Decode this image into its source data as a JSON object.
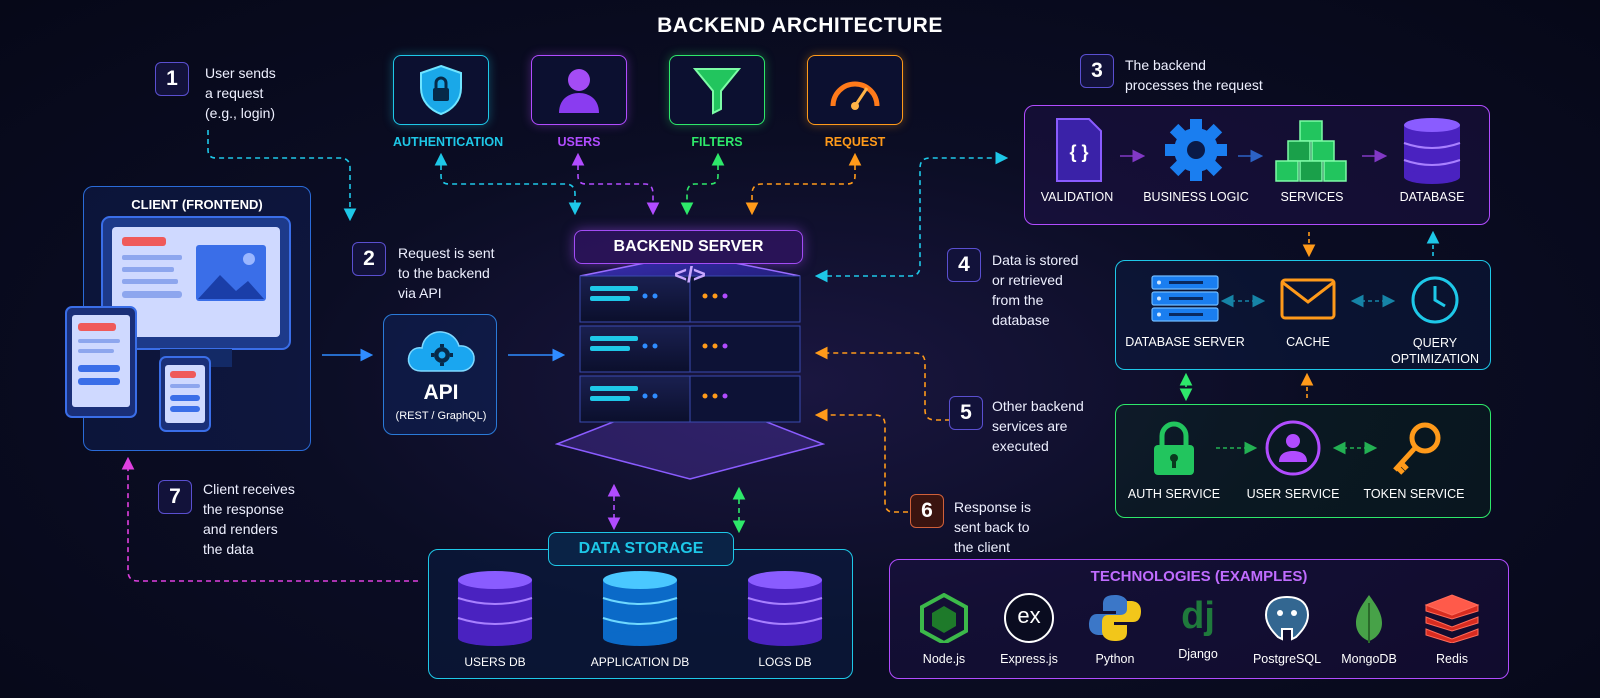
{
  "title": "BACKEND ARCHITECTURE",
  "top_icons": [
    {
      "label": "AUTHENTICATION",
      "icon": "shield-lock-icon",
      "color": "#1ec8e8"
    },
    {
      "label": "USERS",
      "icon": "user-icon",
      "color": "#b14cff"
    },
    {
      "label": "FILTERS",
      "icon": "funnel-icon",
      "color": "#2ee86a"
    },
    {
      "label": "REQUEST",
      "icon": "gauge-icon",
      "color": "#ff9a1a"
    }
  ],
  "steps": {
    "s1": {
      "num": "1",
      "lines": [
        "User sends",
        "a request",
        "(e.g., login)"
      ]
    },
    "s2": {
      "num": "2",
      "lines": [
        "Request is sent",
        "to the backend",
        "via API"
      ]
    },
    "s3": {
      "num": "3",
      "lines": [
        "The backend",
        "processes the request"
      ]
    },
    "s4": {
      "num": "4",
      "lines": [
        "Data is stored",
        "or retrieved",
        "from the",
        "database"
      ]
    },
    "s5": {
      "num": "5",
      "lines": [
        "Other backend",
        "services are",
        "executed"
      ]
    },
    "s6": {
      "num": "6",
      "lines": [
        "Response is",
        "sent back to",
        "the client"
      ]
    },
    "s7": {
      "num": "7",
      "lines": [
        "Client receives",
        "the response",
        "and renders",
        "the data"
      ]
    }
  },
  "client": {
    "label": "CLIENT (FRONTEND)"
  },
  "api": {
    "label": "API",
    "sub": "(REST / GraphQL)"
  },
  "server": {
    "label": "BACKEND SERVER",
    "code": "</>"
  },
  "processing": [
    {
      "label": "VALIDATION",
      "icon": "code-file-icon"
    },
    {
      "label": "BUSINESS LOGIC",
      "icon": "gear-icon"
    },
    {
      "label": "SERVICES",
      "icon": "cubes-icon"
    },
    {
      "label": "DATABASE",
      "icon": "database-icon"
    }
  ],
  "data_layer": {
    "items": [
      {
        "label": "DATABASE SERVER",
        "icon": "server-rack-icon"
      },
      {
        "label": "CACHE",
        "icon": "envelope-icon"
      },
      {
        "label": "QUERY",
        "label2": "OPTIMIZATION",
        "icon": "clock-icon"
      }
    ]
  },
  "services": [
    {
      "label": "AUTH SERVICE",
      "icon": "padlock-icon"
    },
    {
      "label": "USER SERVICE",
      "icon": "user-circle-icon"
    },
    {
      "label": "TOKEN SERVICE",
      "icon": "key-icon"
    }
  ],
  "storage": {
    "label": "DATA STORAGE",
    "dbs": [
      {
        "label": "USERS DB",
        "color": "#6b3cf0"
      },
      {
        "label": "APPLICATION DB",
        "color": "#1aa6f0"
      },
      {
        "label": "LOGS DB",
        "color": "#6b3cf0"
      }
    ]
  },
  "tech": {
    "label": "TECHNOLOGIES (EXAMPLES)",
    "items": [
      {
        "name": "Node.js",
        "icon": "nodejs-icon",
        "glyph": ""
      },
      {
        "name": "Express.js",
        "icon": "express-icon",
        "glyph": "ex"
      },
      {
        "name": "Python",
        "icon": "python-icon",
        "glyph": ""
      },
      {
        "name": "Django",
        "icon": "django-icon",
        "glyph": "dj"
      },
      {
        "name": "PostgreSQL",
        "icon": "postgresql-icon",
        "glyph": ""
      },
      {
        "name": "MongoDB",
        "icon": "mongodb-icon",
        "glyph": ""
      },
      {
        "name": "Redis",
        "icon": "redis-icon",
        "glyph": ""
      }
    ]
  },
  "colors": {
    "cyan": "#1ec8e8",
    "purple": "#b14cff",
    "green": "#2ee86a",
    "orange": "#ff9a1a",
    "blue": "#2f8cff",
    "magenta": "#e040e0"
  }
}
